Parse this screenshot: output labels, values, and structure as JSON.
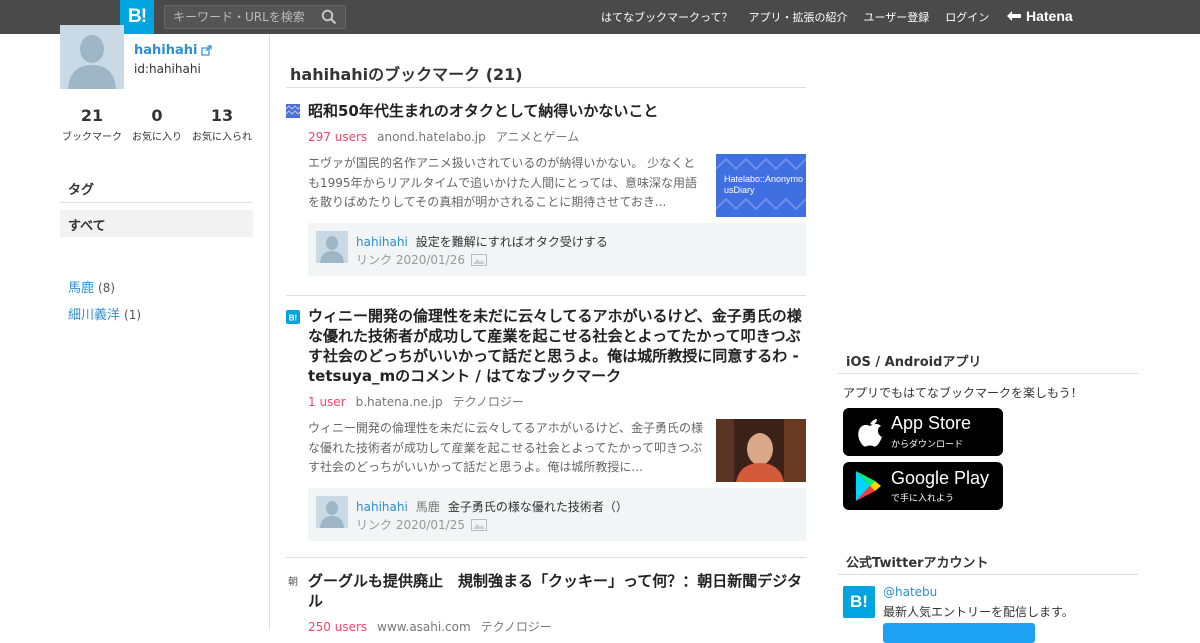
{
  "header": {
    "logo": "B!",
    "search_placeholder": "キーワード・URLを検索",
    "nav": [
      "はてなブックマークって？",
      "アプリ・拡張の紹介",
      "ユーザー登録",
      "ログイン"
    ],
    "brand": "Hatena"
  },
  "profile": {
    "name": "hahihahi",
    "id": "id:hahihahi",
    "stats": [
      {
        "num": "21",
        "label": "ブックマーク"
      },
      {
        "num": "0",
        "label": "お気に入り"
      },
      {
        "num": "13",
        "label": "お気に入られ"
      }
    ]
  },
  "tags": {
    "title": "タグ",
    "all": "すべて",
    "items": [
      {
        "name": "馬鹿",
        "count": "(8)"
      },
      {
        "name": "細川義洋",
        "count": "(1)"
      }
    ]
  },
  "main": {
    "title": "hahihahiのブックマーク (21)",
    "entries": [
      {
        "title": "昭和50年代生まれのオタクとして納得いかないこと",
        "users": "297 users",
        "domain": "anond.hatelabo.jp",
        "category": "アニメとゲーム",
        "desc": "エヴァが国民的名作アニメ扱いされているのが納得いかない。 少なくとも1995年からリアルタイムで追いかけた人間にとっては、意味深な用語を散りばめたりしてその真相が明かされることに期待させておき...",
        "thumb_text": "Hatelabo::AnonymousDiary",
        "comment": {
          "user": "hahihahi",
          "tag": "",
          "text": "設定を難解にすればオタク受けする",
          "date": "リンク 2020/01/26"
        }
      },
      {
        "title": "ウィニー開発の倫理性を未だに云々してるアホがいるけど、金子勇氏の様な優れた技術者が成功して産業を起こせる社会とよってたかって叩きつぶす社会のどっちがいいかって話だと思うよ。俺は城所教授に同意するわ - tetsuya_mのコメント / はてなブックマーク",
        "users": "1 user",
        "domain": "b.hatena.ne.jp",
        "category": "テクノロジー",
        "desc": "ウィニー開発の倫理性を未だに云々してるアホがいるけど、金子勇氏の様な優れた技術者が成功して産業を起こせる社会とよってたかって叩きつぶす社会のどっちがいいかって話だと思うよ。俺は城所教授に...",
        "comment": {
          "user": "hahihahi",
          "tag": "馬鹿",
          "text": "金子勇氏の様な優れた技術者（）",
          "date": "リンク 2020/01/25"
        }
      },
      {
        "title": "グーグルも提供廃止　規制強まる「クッキー」って何？：朝日新聞デジタル",
        "users": "250 users",
        "domain": "www.asahi.com",
        "category": "テクノロジー"
      }
    ]
  },
  "right": {
    "app_title": "iOS / Androidアプリ",
    "app_text": "アプリでもはてなブックマークを楽しもう！",
    "appstore_small": "からダウンロード",
    "appstore_large": "App Store",
    "gplay_small": "で手に入れよう",
    "gplay_large": "Google Play",
    "twitter_title": "公式Twitterアカウント",
    "twitter_logo": "B!",
    "twitter_handle": "@hatebu",
    "twitter_desc": "最新人気エントリーを配信します。"
  },
  "colors": {
    "header_bg": "#4a4a4a",
    "brand_blue": "#00a4de",
    "link": "#2c8fd1",
    "users_red": "#ff4166"
  }
}
